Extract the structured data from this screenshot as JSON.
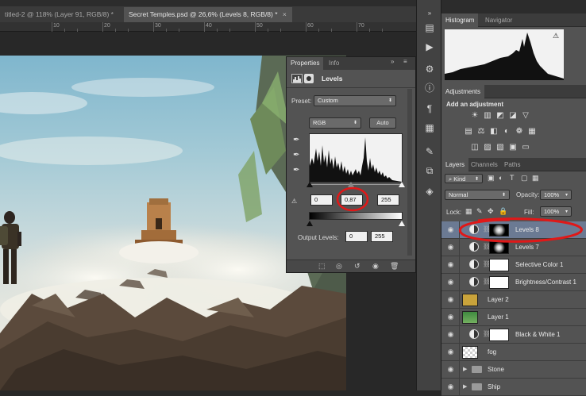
{
  "tabs": [
    {
      "label": "titled-2 @ 118% (Layer 91, RGB/8) *",
      "close": "×"
    },
    {
      "label": "Secret Temples.psd @ 26,6% (Levels 8, RGB/8) *",
      "close": "×"
    }
  ],
  "ruler": {
    "labels": [
      "10",
      "20",
      "30",
      "40",
      "50",
      "60",
      "70"
    ]
  },
  "properties": {
    "tabs": [
      "Properties",
      "Info"
    ],
    "adjustment_name": "Levels",
    "preset_label": "Preset:",
    "preset_value": "Custom",
    "channel_value": "RGB",
    "auto_label": "Auto",
    "input_black": "0",
    "input_gamma": "0,87",
    "input_white": "255",
    "output_label": "Output Levels:",
    "output_black": "0",
    "output_white": "255"
  },
  "histogram_panel": {
    "tabs": [
      "Histogram",
      "Navigator"
    ],
    "warning_icon": "⚠"
  },
  "adjustments_panel": {
    "tab": "Adjustments",
    "heading": "Add an adjustment"
  },
  "layers_panel": {
    "tabs": [
      "Layers",
      "Channels",
      "Paths"
    ],
    "kind_filter": "Kind",
    "blend_mode": "Normal",
    "opacity_label": "Opacity:",
    "opacity_value": "100%",
    "lock_label": "Lock:",
    "fill_label": "Fill:",
    "fill_value": "100%",
    "layers": [
      {
        "name": "Levels 8",
        "type": "adjustment",
        "selected": true,
        "mask": "dark"
      },
      {
        "name": "Levels 7",
        "type": "adjustment",
        "selected": false,
        "mask": "dark"
      },
      {
        "name": "Selective Color 1",
        "type": "adjustment",
        "selected": false,
        "mask": "white"
      },
      {
        "name": "Brightness/Contrast 1",
        "type": "adjustment",
        "selected": false,
        "mask": "white"
      },
      {
        "name": "Layer 2",
        "type": "fill",
        "selected": false,
        "color": "#c9a33b"
      },
      {
        "name": "Layer 1",
        "type": "fill",
        "selected": false,
        "color": "#4a9a4a"
      },
      {
        "name": "Black & White 1",
        "type": "adjustment",
        "selected": false,
        "mask": "white"
      },
      {
        "name": "fog",
        "type": "raster",
        "selected": false
      },
      {
        "name": "Stone",
        "type": "group",
        "selected": false
      },
      {
        "name": "Ship",
        "type": "group",
        "selected": false
      }
    ]
  },
  "colors": {
    "annotation_red": "#e01818",
    "selected_layer": "#6b7a93",
    "panel_bg": "#535353"
  }
}
